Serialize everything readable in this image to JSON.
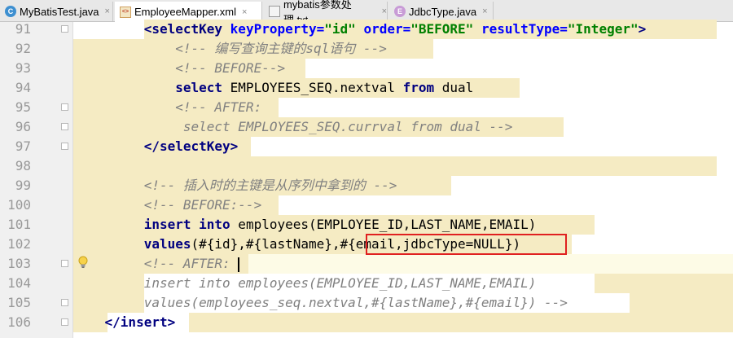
{
  "tabs": [
    {
      "label": "MyBatisTest.java",
      "icon": "java-class-icon",
      "active": false
    },
    {
      "label": "EmployeeMapper.xml",
      "icon": "xml-file-icon",
      "active": true
    },
    {
      "label": "mybatis参数处理.txt",
      "icon": "text-file-icon",
      "active": false
    },
    {
      "label": "JdbcType.java",
      "icon": "java-enum-icon",
      "active": false
    }
  ],
  "editor": {
    "lines": [
      {
        "num": "91"
      },
      {
        "num": "92"
      },
      {
        "num": "93"
      },
      {
        "num": "94"
      },
      {
        "num": "95"
      },
      {
        "num": "96"
      },
      {
        "num": "97"
      },
      {
        "num": "98"
      },
      {
        "num": "99"
      },
      {
        "num": "100"
      },
      {
        "num": "101"
      },
      {
        "num": "102"
      },
      {
        "num": "103"
      },
      {
        "num": "104"
      },
      {
        "num": "105"
      },
      {
        "num": "106"
      }
    ],
    "current_line": "103"
  },
  "colors": {
    "highlight": "#f5ebc3",
    "keyword": "#000080",
    "attribute": "#0000ff",
    "string": "#008000",
    "comment": "#808080",
    "annotation_box": "#e02020"
  }
}
